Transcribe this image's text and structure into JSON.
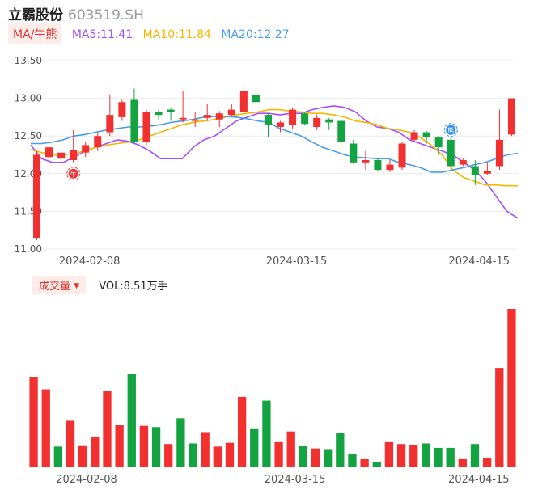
{
  "header": {
    "name": "立霸股份",
    "code": "603519.SH"
  },
  "ma_legend": {
    "toggle": "MA/牛熊",
    "items": [
      {
        "label": "MA5:11.41",
        "color": "#a64dff"
      },
      {
        "label": "MA10:11.84",
        "color": "#f5b800"
      },
      {
        "label": "MA20:12.27",
        "color": "#4a9de8"
      }
    ]
  },
  "volume_legend": {
    "toggle": "成交量",
    "caret": "▼",
    "value": "VOL:8.51万手"
  },
  "colors": {
    "up": "#f23030",
    "down": "#13a341",
    "grid": "#ececec",
    "axis_text": "#555555"
  },
  "markers": [
    {
      "label": "牛",
      "index": 3,
      "value": 12.0,
      "color": "#f23030",
      "icon": "bull-marker-icon"
    },
    {
      "label": "熊",
      "index": 34,
      "value": 12.58,
      "color": "#2a8cf0",
      "icon": "bear-marker-icon"
    }
  ],
  "chart_data": [
    {
      "type": "candlestick",
      "y_ticks": [
        "13.50",
        "13.00",
        "12.50",
        "12.00",
        "11.50",
        "11.00"
      ],
      "ylim": [
        11.0,
        13.5
      ],
      "x_tick_labels": [
        {
          "label": "2024-02-08",
          "index": 3
        },
        {
          "label": "2024-03-15",
          "index": 20
        },
        {
          "label": "2024-04-15",
          "index": 35
        }
      ],
      "candles": [
        {
          "o": 11.15,
          "c": 12.25,
          "h": 12.3,
          "l": 11.12
        },
        {
          "o": 12.22,
          "c": 12.35,
          "h": 12.45,
          "l": 12.0
        },
        {
          "o": 12.2,
          "c": 12.28,
          "h": 12.32,
          "l": 12.12
        },
        {
          "o": 12.18,
          "c": 12.32,
          "h": 12.58,
          "l": 12.15
        },
        {
          "o": 12.28,
          "c": 12.38,
          "h": 12.42,
          "l": 12.22
        },
        {
          "o": 12.35,
          "c": 12.5,
          "h": 12.55,
          "l": 12.3
        },
        {
          "o": 12.55,
          "c": 12.78,
          "h": 13.05,
          "l": 12.5
        },
        {
          "o": 12.75,
          "c": 12.95,
          "h": 12.98,
          "l": 12.7
        },
        {
          "o": 12.98,
          "c": 12.42,
          "h": 13.13,
          "l": 12.4
        },
        {
          "o": 12.42,
          "c": 12.82,
          "h": 12.85,
          "l": 12.38
        },
        {
          "o": 12.82,
          "c": 12.78,
          "h": 12.85,
          "l": 12.72
        },
        {
          "o": 12.85,
          "c": 12.82,
          "h": 12.88,
          "l": 12.7
        },
        {
          "o": 12.72,
          "c": 12.74,
          "h": 13.1,
          "l": 12.68
        },
        {
          "o": 12.7,
          "c": 12.72,
          "h": 12.82,
          "l": 12.62
        },
        {
          "o": 12.74,
          "c": 12.78,
          "h": 12.92,
          "l": 12.7
        },
        {
          "o": 12.72,
          "c": 12.8,
          "h": 12.83,
          "l": 12.62
        },
        {
          "o": 12.78,
          "c": 12.85,
          "h": 12.92,
          "l": 12.76
        },
        {
          "o": 12.82,
          "c": 13.1,
          "h": 13.17,
          "l": 12.8
        },
        {
          "o": 13.05,
          "c": 12.95,
          "h": 13.1,
          "l": 12.9
        },
        {
          "o": 12.78,
          "c": 12.65,
          "h": 12.8,
          "l": 12.48
        },
        {
          "o": 12.62,
          "c": 12.68,
          "h": 12.7,
          "l": 12.55
        },
        {
          "o": 12.65,
          "c": 12.85,
          "h": 12.88,
          "l": 12.6
        },
        {
          "o": 12.8,
          "c": 12.66,
          "h": 12.82,
          "l": 12.64
        },
        {
          "o": 12.62,
          "c": 12.74,
          "h": 12.78,
          "l": 12.58
        },
        {
          "o": 12.72,
          "c": 12.68,
          "h": 12.74,
          "l": 12.58
        },
        {
          "o": 12.7,
          "c": 12.42,
          "h": 12.72,
          "l": 12.4
        },
        {
          "o": 12.4,
          "c": 12.15,
          "h": 12.45,
          "l": 12.13
        },
        {
          "o": 12.15,
          "c": 12.18,
          "h": 12.3,
          "l": 12.05
        },
        {
          "o": 12.18,
          "c": 12.05,
          "h": 12.2,
          "l": 12.03
        },
        {
          "o": 12.05,
          "c": 12.12,
          "h": 12.18,
          "l": 12.02
        },
        {
          "o": 12.08,
          "c": 12.4,
          "h": 12.42,
          "l": 12.05
        },
        {
          "o": 12.45,
          "c": 12.55,
          "h": 12.58,
          "l": 12.42
        },
        {
          "o": 12.55,
          "c": 12.48,
          "h": 12.57,
          "l": 12.4
        },
        {
          "o": 12.48,
          "c": 12.35,
          "h": 12.5,
          "l": 12.25
        },
        {
          "o": 12.45,
          "c": 12.1,
          "h": 12.48,
          "l": 12.08
        },
        {
          "o": 12.12,
          "c": 12.18,
          "h": 12.2,
          "l": 12.1
        },
        {
          "o": 12.1,
          "c": 11.98,
          "h": 12.18,
          "l": 11.85
        },
        {
          "o": 12.0,
          "c": 12.03,
          "h": 12.15,
          "l": 11.98
        },
        {
          "o": 12.1,
          "c": 12.45,
          "h": 12.85,
          "l": 12.05
        },
        {
          "o": 12.52,
          "c": 13.0,
          "h": 13.0,
          "l": 12.5
        }
      ],
      "ma_lines": [
        {
          "name": "MA5",
          "color": "#a64dff",
          "values": [
            12.38,
            12.2,
            12.15,
            12.15,
            12.22,
            12.3,
            12.35,
            12.4,
            12.45,
            12.43,
            12.38,
            12.3,
            12.2,
            12.2,
            12.2,
            12.35,
            12.45,
            12.5,
            12.6,
            12.7,
            12.75,
            12.8,
            12.8,
            12.78,
            12.8,
            12.8,
            12.85,
            12.88,
            12.9,
            12.88,
            12.82,
            12.7,
            12.62,
            12.6,
            12.55,
            12.45,
            12.4,
            12.35,
            12.3,
            12.25,
            12.15,
            12.05,
            11.9,
            11.7,
            11.5,
            11.41
          ]
        },
        {
          "name": "MA10",
          "color": "#f5b800",
          "values": [
            12.32,
            12.28,
            12.25,
            12.25,
            12.27,
            12.3,
            12.35,
            12.38,
            12.4,
            12.42,
            12.45,
            12.5,
            12.55,
            12.6,
            12.65,
            12.68,
            12.7,
            12.72,
            12.75,
            12.78,
            12.8,
            12.82,
            12.85,
            12.85,
            12.83,
            12.82,
            12.8,
            12.8,
            12.78,
            12.75,
            12.7,
            12.68,
            12.65,
            12.6,
            12.58,
            12.55,
            12.48,
            12.38,
            12.25,
            12.05,
            11.95,
            11.9,
            11.85,
            11.85,
            11.84,
            11.84
          ]
        },
        {
          "name": "MA20",
          "color": "#4a9de8",
          "values": [
            12.4,
            12.4,
            12.42,
            12.45,
            12.5,
            12.52,
            12.55,
            12.58,
            12.6,
            12.62,
            12.62,
            12.63,
            12.65,
            12.68,
            12.7,
            12.72,
            12.75,
            12.76,
            12.76,
            12.75,
            12.73,
            12.7,
            12.68,
            12.6,
            12.55,
            12.5,
            12.42,
            12.35,
            12.3,
            12.25,
            12.22,
            12.21,
            12.2,
            12.2,
            12.15,
            12.12,
            12.08,
            12.02,
            12.02,
            12.05,
            12.08,
            12.12,
            12.15,
            12.2,
            12.25,
            12.27
          ]
        }
      ]
    },
    {
      "type": "bar",
      "series_name": "成交量",
      "x_tick_labels": [
        {
          "label": "2024-02-08",
          "index": 3
        },
        {
          "label": "2024-03-15",
          "index": 20
        },
        {
          "label": "2024-04-15",
          "index": 35
        }
      ],
      "ylim": [
        0,
        20
      ],
      "values": [
        {
          "v": 14.4,
          "up": true
        },
        {
          "v": 12.4,
          "up": true
        },
        {
          "v": 3.3,
          "up": false
        },
        {
          "v": 7.4,
          "up": true
        },
        {
          "v": 3.5,
          "up": true
        },
        {
          "v": 4.9,
          "up": true
        },
        {
          "v": 12.2,
          "up": true
        },
        {
          "v": 6.8,
          "up": true
        },
        {
          "v": 14.8,
          "up": false
        },
        {
          "v": 6.6,
          "up": true
        },
        {
          "v": 6.4,
          "up": false
        },
        {
          "v": 3.7,
          "up": true
        },
        {
          "v": 7.8,
          "up": false
        },
        {
          "v": 3.8,
          "up": false
        },
        {
          "v": 5.6,
          "up": true
        },
        {
          "v": 3.3,
          "up": true
        },
        {
          "v": 3.9,
          "up": true
        },
        {
          "v": 11.2,
          "up": true
        },
        {
          "v": 6.2,
          "up": false
        },
        {
          "v": 10.6,
          "up": false
        },
        {
          "v": 4.0,
          "up": true
        },
        {
          "v": 5.7,
          "up": true
        },
        {
          "v": 3.4,
          "up": false
        },
        {
          "v": 3.0,
          "up": true
        },
        {
          "v": 2.9,
          "up": false
        },
        {
          "v": 5.5,
          "up": false
        },
        {
          "v": 2.1,
          "up": false
        },
        {
          "v": 1.3,
          "up": true
        },
        {
          "v": 0.9,
          "up": false
        },
        {
          "v": 4.0,
          "up": true
        },
        {
          "v": 3.7,
          "up": true
        },
        {
          "v": 3.6,
          "up": true
        },
        {
          "v": 3.8,
          "up": false
        },
        {
          "v": 3.1,
          "up": false
        },
        {
          "v": 3.1,
          "up": false
        },
        {
          "v": 1.3,
          "up": true
        },
        {
          "v": 3.7,
          "up": false
        },
        {
          "v": 1.5,
          "up": true
        },
        {
          "v": 15.8,
          "up": true
        },
        {
          "v": 25.2,
          "up": true
        }
      ]
    }
  ]
}
